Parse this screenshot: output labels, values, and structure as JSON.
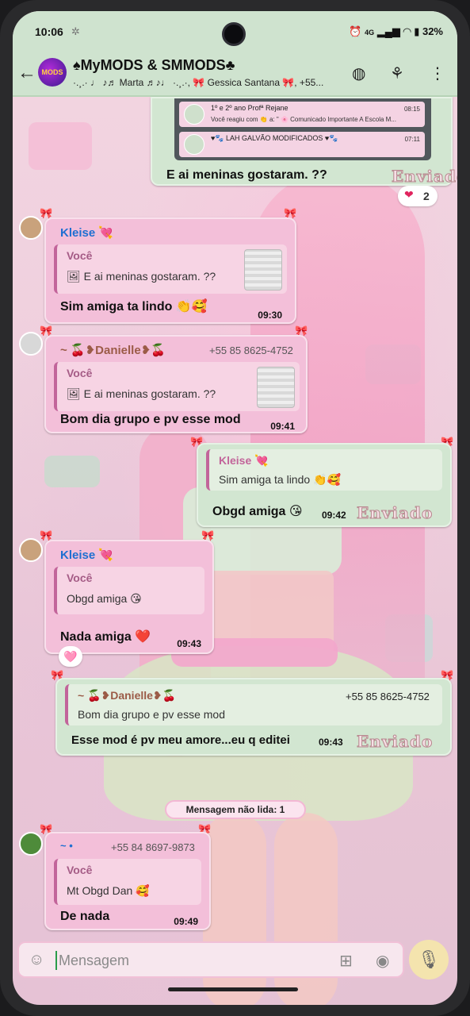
{
  "status_bar": {
    "time": "10:06",
    "settings_icon": "gear-icon",
    "battery": "32%",
    "network": "4G"
  },
  "header": {
    "avatar_text": "MODS",
    "title": "♠MyMODS & SMMODS♣",
    "subtitle": "·.¸.· ♩ ♪♬ Marta ♬♪♩ ·.¸.·, 🎀 Gessica Santana 🎀, +55...",
    "icons": [
      "back-arrow-icon",
      "community-icon",
      "video-call-icon",
      "more-vert-icon"
    ]
  },
  "top_card": {
    "rows": [
      {
        "name": "1º e 2º ano Profª Rejane",
        "text": "Você reagiu com 👏 a: \" 🌸 Comunicado Importante A Escola M...",
        "time": "08:15"
      },
      {
        "name": "♥🐾 LAH GALVÃO MODIFICADOS ♥🐾",
        "text": "",
        "time": "07:11"
      }
    ],
    "message": "E ai meninas gostaram. ??",
    "status": "Enviado",
    "reaction_count": "2"
  },
  "messages": [
    {
      "sender": "Kleise 💘",
      "quote_name": "Você",
      "quote_text": "🖼 E ai meninas gostaram. ??",
      "text": "Sim amiga ta lindo 👏🥰",
      "time": "09:30"
    },
    {
      "sender": "~ 🍒❥Danielle❥🍒",
      "phone": "+55 85 8625-4752",
      "quote_name": "Você",
      "quote_text": "🖼 E ai meninas gostaram. ??",
      "text": "Bom dia grupo e pv esse mod",
      "time": "09:41"
    },
    {
      "sender": "Kleise 💘",
      "quote_text": "Sim amiga ta lindo 👏🥰",
      "text": "Obgd amiga 😘",
      "time": "09:42",
      "status": "Enviado"
    },
    {
      "sender": "Kleise 💘",
      "quote_name": "Você",
      "quote_text": "Obgd amiga 😘",
      "text": "Nada amiga ❤️",
      "time": "09:43",
      "reaction": "🩷"
    },
    {
      "sender": "~ 🍒❥Danielle❥🍒",
      "phone": "+55 85 8625-4752",
      "quote_text": "Bom dia grupo e pv esse mod",
      "text": "Esse mod é pv meu amore...eu q editei",
      "time": "09:43",
      "status": "Enviado"
    },
    {
      "sender": "~ •",
      "phone": "+55 84 8697-9873",
      "quote_name": "Você",
      "quote_text": "Mt Obgd Dan 🥰",
      "text": "De nada",
      "time": "09:49"
    }
  ],
  "unread_label": "Mensagem não lida: 1",
  "input": {
    "placeholder": "Mensagem",
    "icons": [
      "sticker-icon",
      "attach-icon",
      "camera-icon",
      "mic-icon"
    ]
  }
}
